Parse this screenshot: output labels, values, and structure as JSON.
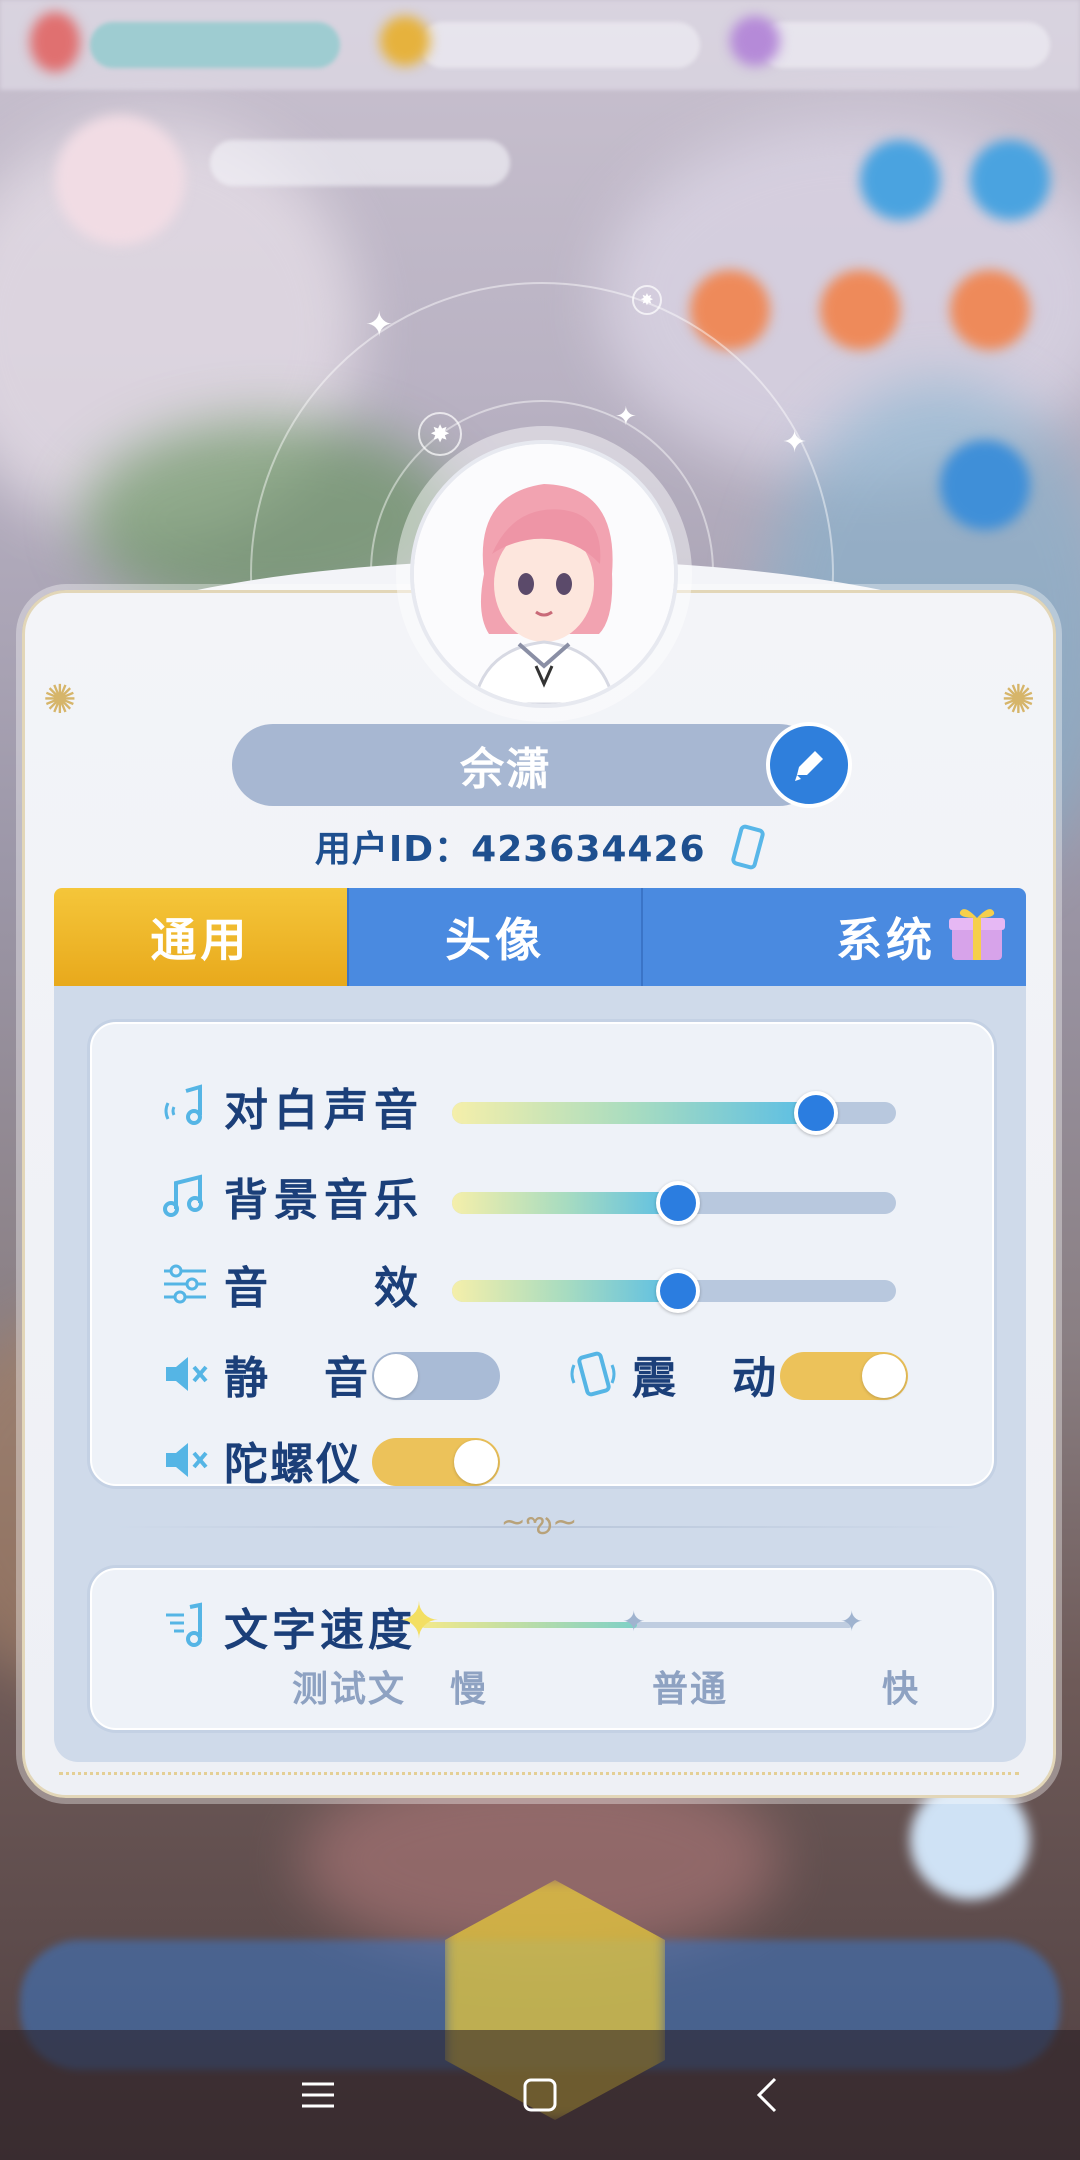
{
  "profile": {
    "name": "佘潇",
    "user_id_label": "用户ID：",
    "user_id": "423634426"
  },
  "tabs": [
    {
      "label": "通用",
      "active": true
    },
    {
      "label": "头像",
      "active": false
    },
    {
      "label": "系统",
      "active": false
    }
  ],
  "audio": {
    "dialogue": {
      "label": "对白声音",
      "value": 0.82
    },
    "bgm": {
      "label": "背景音乐",
      "value": 0.51
    },
    "sfx": {
      "label": "音　　效",
      "value": 0.51
    },
    "mute": {
      "label": "静　音",
      "on": false
    },
    "vibration": {
      "label": "震　动",
      "on": true
    },
    "gyroscope": {
      "label": "陀螺仪",
      "on": true
    }
  },
  "text_speed": {
    "label": "文字速度",
    "preview": "测试文",
    "options": [
      "慢",
      "普通",
      "快"
    ],
    "value": 0.5
  },
  "colors": {
    "accent_blue": "#2f7fdc",
    "tab_active": "#f5c63a",
    "toggle_on": "#ecc25a",
    "toggle_off": "#a9bbd6"
  },
  "icons": {
    "edit": "pencil-icon",
    "copy": "phone-copy-icon",
    "gift": "gift-icon",
    "dialogue": "voice-note-icon",
    "bgm": "music-note-icon",
    "sfx": "equalizer-icon",
    "mute": "speaker-muted-icon",
    "vibration": "vibrate-icon",
    "gyroscope": "speaker-muted-icon",
    "speed": "text-speed-icon"
  },
  "navbar": [
    "menu-icon",
    "home-icon",
    "back-icon"
  ]
}
